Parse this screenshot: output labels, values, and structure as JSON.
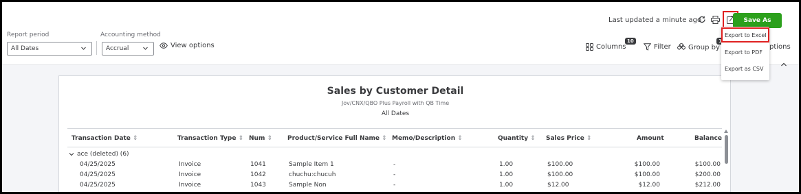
{
  "header": {
    "last_updated": "Last updated a minute ago",
    "save_as_label": "Save As"
  },
  "filters": {
    "report_period_label": "Report period",
    "report_period_value": "All Dates",
    "accounting_method_label": "Accounting method",
    "accounting_method_value": "Accrual",
    "view_options_label": "View options"
  },
  "toolbar": {
    "columns_label": "Columns",
    "columns_count": "10",
    "filter_label": "Filter",
    "group_by_label": "Group by",
    "group_by_count": "1",
    "options_partial_label": "ptions"
  },
  "export_menu": {
    "items": [
      "Export to Excel",
      "Export to PDF",
      "Export as CSV"
    ]
  },
  "report": {
    "title": "Sales by Customer Detail",
    "company": "Jov/CNX/QBO Plus Payroll with QB Time",
    "dates": "All Dates",
    "columns": [
      "Transaction Date",
      "Transaction Type",
      "Num",
      "Product/Service Full Name",
      "Memo/Description",
      "Quantity",
      "Sales Price",
      "Amount",
      "Balance"
    ],
    "group": "ace (deleted) (6)",
    "rows": [
      {
        "date": "04/25/2025",
        "type": "Invoice",
        "num": "1041",
        "product": "Sample Item 1",
        "memo": "-",
        "qty": "1.00",
        "price": "$100.00",
        "amount": "$100.00",
        "balance": "$100.00"
      },
      {
        "date": "04/25/2025",
        "type": "Invoice",
        "num": "1042",
        "product": "chuchu:chucuh",
        "memo": "-",
        "qty": "1.00",
        "price": "$100.00",
        "amount": "$100.00",
        "balance": "$200.00"
      },
      {
        "date": "04/25/2025",
        "type": "Invoice",
        "num": "1043",
        "product": "Sample Non",
        "memo": "-",
        "qty": "1.00",
        "price": "$12.00",
        "amount": "$12.00",
        "balance": "$212.00"
      }
    ]
  },
  "colors": {
    "save_green": "#2ca01c",
    "highlight_red": "#e02020"
  }
}
